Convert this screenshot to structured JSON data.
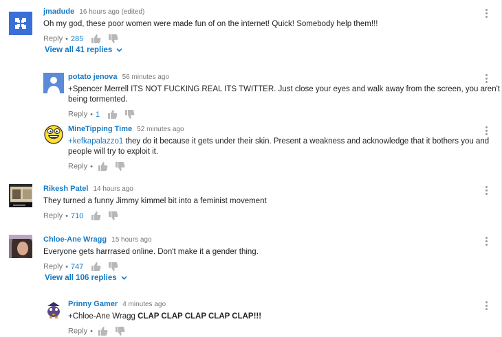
{
  "comments": [
    {
      "author": "jmadude",
      "time": "16 hours ago (edited)",
      "text": "Oh my god, these poor women were made fun of on the internet! Quick! Somebody help them!!!",
      "reply_label": "Reply",
      "likes": "285",
      "view_all": "View all 41 replies",
      "avatar_color": "#3a6fd8"
    },
    {
      "author": "potato jenova",
      "time": "56 minutes ago",
      "text_line1": "+Spencer Merrell ITS NOT FUCKING REAL ITS TWITTER. Just close your eyes and walk away from the screen, you aren't",
      "text_line2": "being tormented.",
      "reply_label": "Reply",
      "likes": "1",
      "avatar_color": "#4a7fd8"
    },
    {
      "author": "MineTipping Time",
      "time": "52 minutes ago",
      "mention": "+kefkapalazzo1",
      "text_line1": " they do it because it gets under their skin. Present a weakness and acknowledge that it bothers you and",
      "text_line2": "people will try to exploit it.",
      "reply_label": "Reply",
      "likes": ""
    },
    {
      "author": "Rikesh Patel",
      "time": "14 hours ago",
      "text": "They turned a funny Jimmy kimmel bit into a feminist movement",
      "reply_label": "Reply",
      "likes": "710"
    },
    {
      "author": "Chloe-Ane Wragg",
      "time": "15 hours ago",
      "text": "Everyone gets harrrased online. Don't make it a gender thing.",
      "reply_label": "Reply",
      "likes": "747",
      "view_all": "View all 106 replies"
    },
    {
      "author": "Prinny Gamer",
      "time": "4 minutes ago",
      "text_prefix": "+Chloe-Ane Wragg ",
      "text_bold": "CLAP CLAP CLAP CLAP CLAP!!!",
      "reply_label": "Reply",
      "likes": ""
    }
  ],
  "colors": {
    "link": "#167ac6",
    "meta": "#767676",
    "text": "#222222"
  }
}
